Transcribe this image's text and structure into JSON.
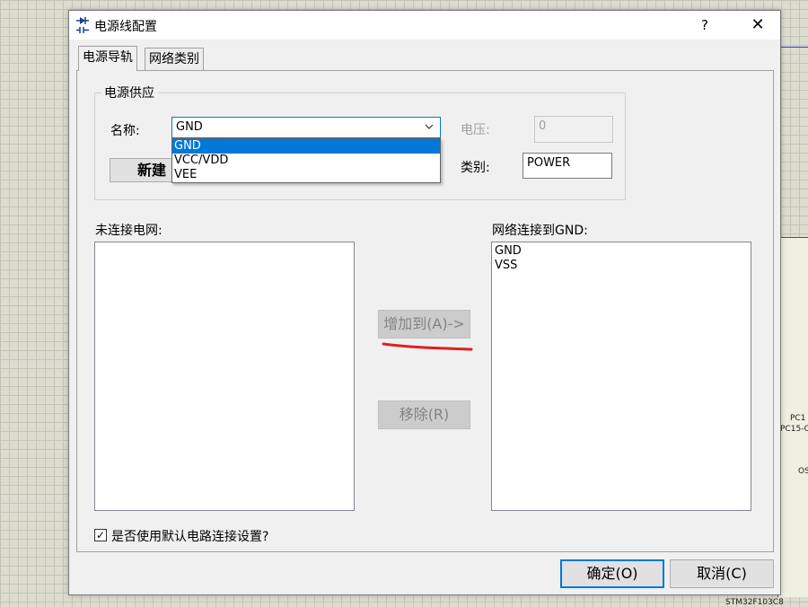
{
  "background": {
    "pin_labels": [
      "PC1",
      "PC15-O",
      "OS",
      "STM32F103C8"
    ]
  },
  "window": {
    "title": "电源线配置",
    "help_glyph": "?",
    "close_glyph": "✕"
  },
  "tabs": [
    {
      "label": "电源导轨",
      "active": true
    },
    {
      "label": "网络类别",
      "active": false
    }
  ],
  "power_supply": {
    "group_label": "电源供应",
    "name_label": "名称:",
    "name_value": "GND",
    "dropdown_options": [
      "GND",
      "VCC/VDD",
      "VEE"
    ],
    "voltage_label": "电压:",
    "voltage_value": "0",
    "class_label": "类别:",
    "class_value": "POWER",
    "new_button": "新建"
  },
  "unconnected": {
    "label": "未连接电网:",
    "items": []
  },
  "connected": {
    "label": "网络连接到GND:",
    "items": [
      "GND",
      "VSS"
    ]
  },
  "actions": {
    "add_to": "增加到(A)->",
    "remove": "移除(R)"
  },
  "checkbox": {
    "label": "是否使用默认电路连接设置?",
    "checked": true,
    "check_glyph": "✓"
  },
  "footer": {
    "ok": "确定(O)",
    "cancel": "取消(C)"
  },
  "colors": {
    "accent": "#0078d7",
    "annotation": "#e02020"
  }
}
